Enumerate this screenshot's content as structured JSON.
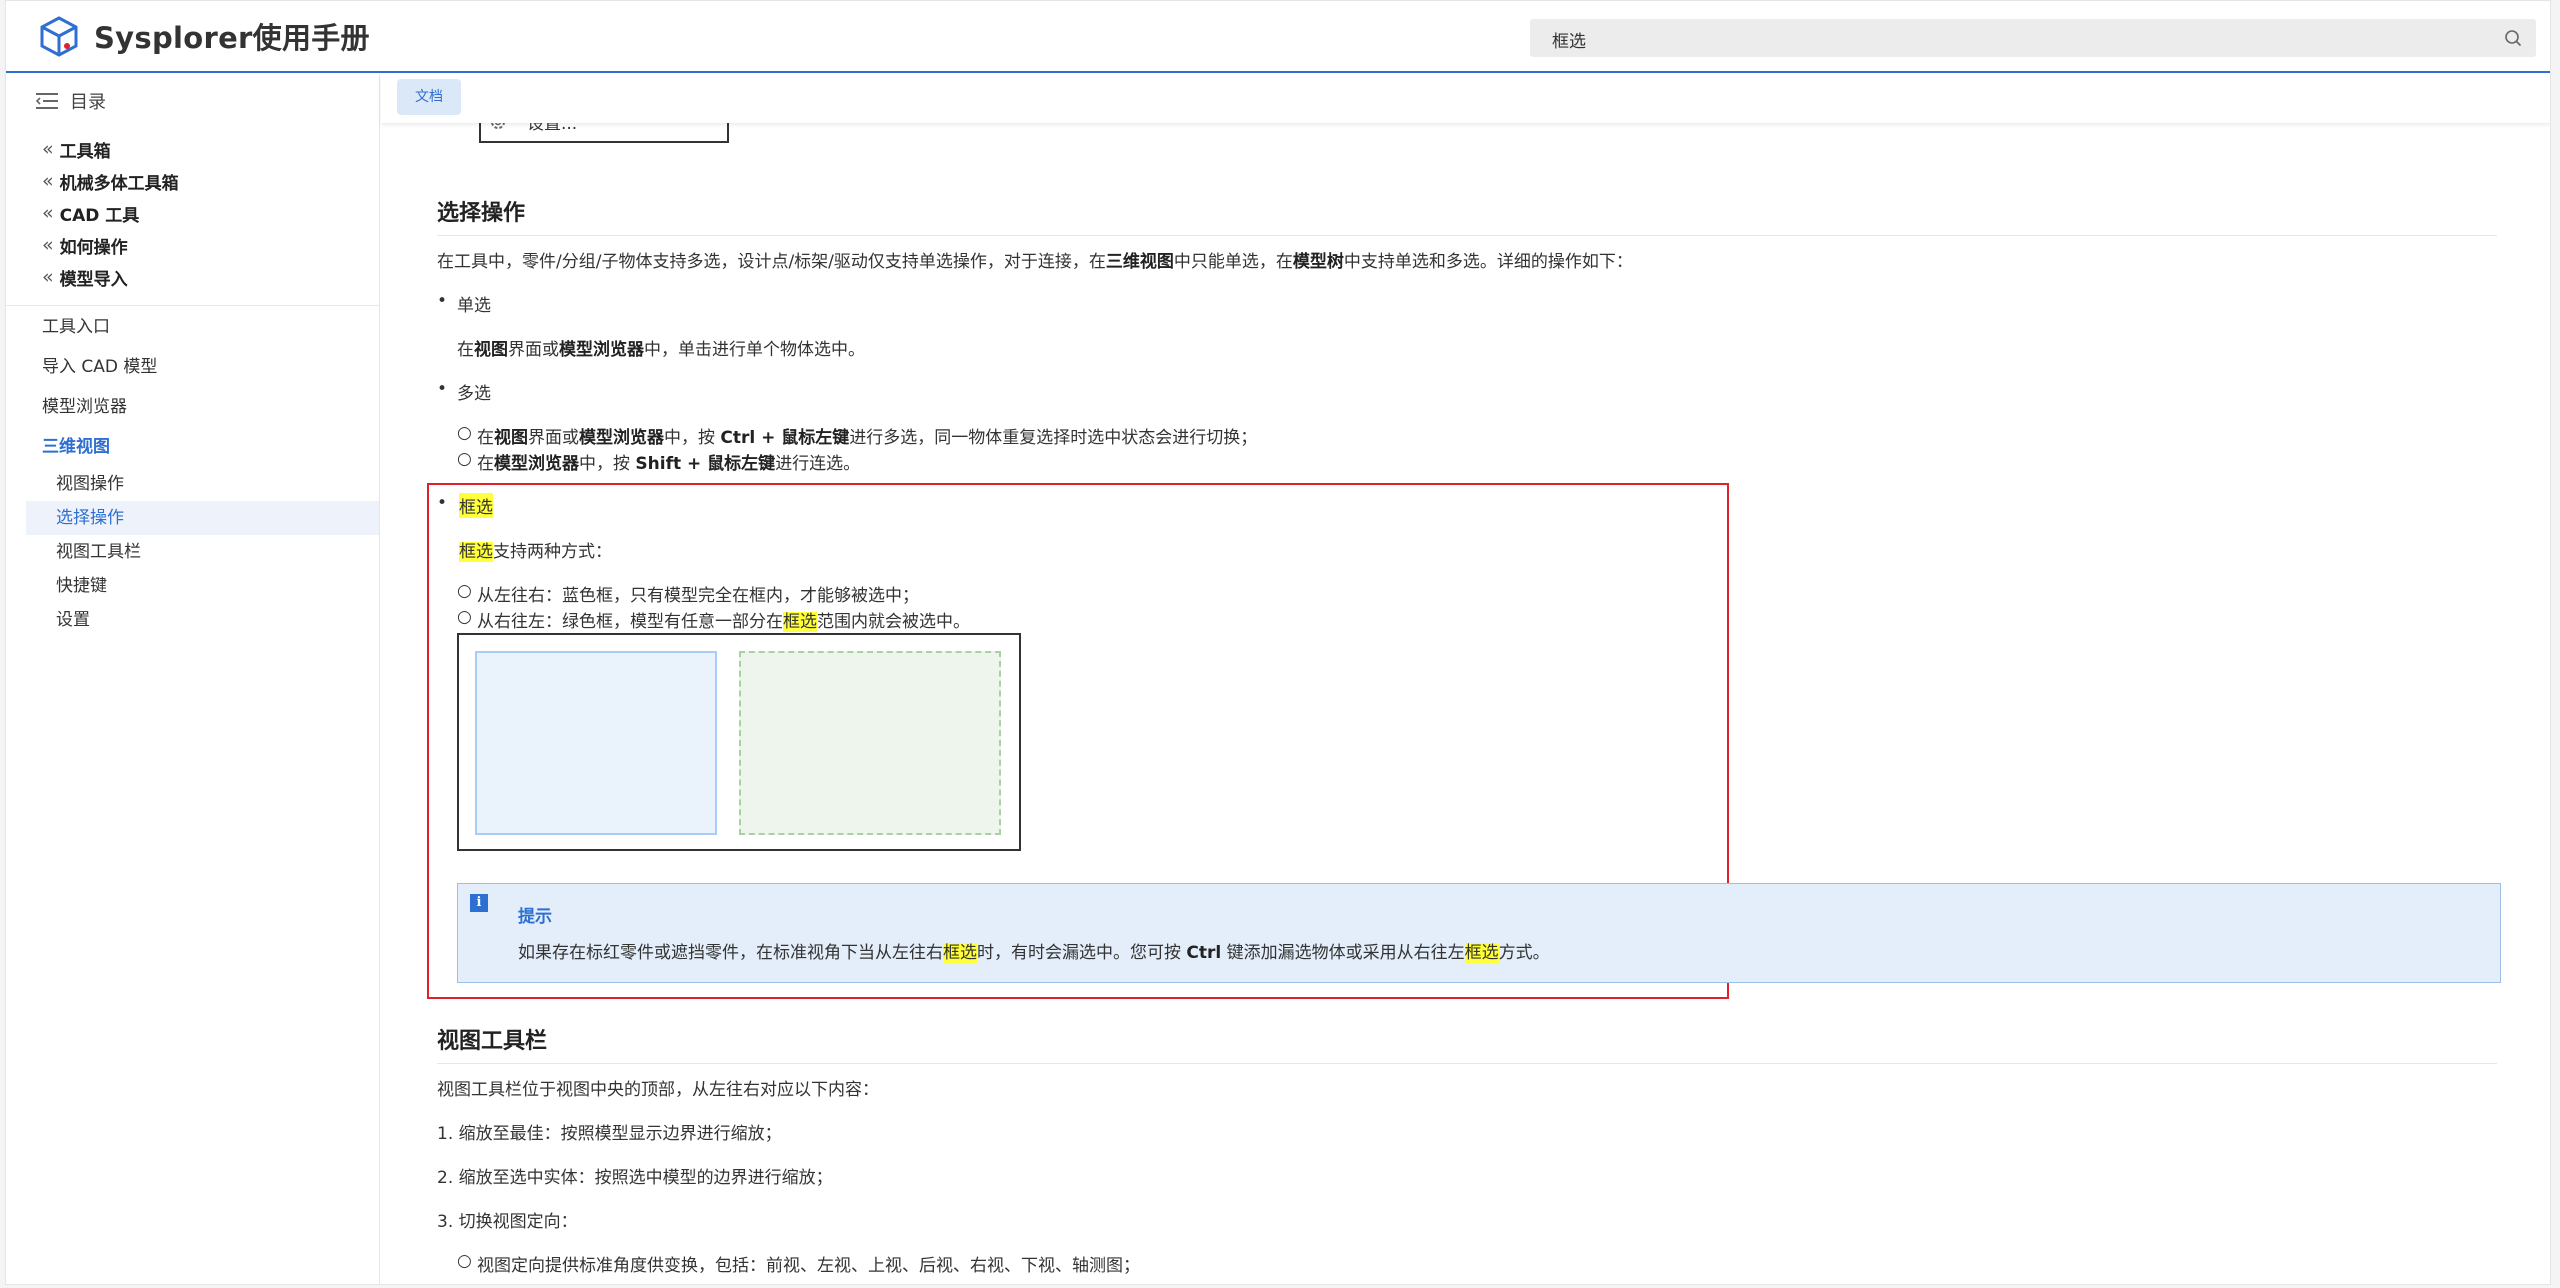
{
  "header": {
    "app_title": "Sysplorer使用手册",
    "search_value": "框选",
    "logo_icon": "cube-logo-icon",
    "search_icon": "search-icon",
    "accent_color": "#2f6fd1"
  },
  "sidebar": {
    "toc_label": "目录",
    "collapsed_sections": [
      "工具箱",
      "机械多体工具箱",
      "CAD 工具",
      "如何操作",
      "模型导入"
    ],
    "items": [
      "工具入口",
      "导入 CAD 模型",
      "模型浏览器",
      "三维视图"
    ],
    "active_item": "三维视图",
    "sub_items": [
      "视图操作",
      "选择操作",
      "视图工具栏",
      "快捷键",
      "设置"
    ],
    "active_sub_item": "选择操作"
  },
  "tabs": {
    "doc_tab": "文档"
  },
  "content": {
    "partial_item": "设置...",
    "section_select": {
      "title": "选择操作",
      "intro": {
        "a": "在工具中，零件/分组/子物体支持多选，设计点/标架/驱动仅支持单选操作，对于连接，在",
        "b1": "三维视图",
        "c": "中只能单选，在",
        "b2": "模型树",
        "d": "中支持单选和多选。详细的操作如下："
      },
      "single": {
        "label": "单选",
        "desc": {
          "a": "在",
          "b1": "视图",
          "c": "界面或",
          "b2": "模型浏览器",
          "d": "中，单击进行单个物体选中。"
        }
      },
      "multi": {
        "label": "多选",
        "items": [
          {
            "a": "在",
            "b1": "视图",
            "c": "界面或",
            "b2": "模型浏览器",
            "d": "中，按 ",
            "b3": "Ctrl + 鼠标左键",
            "e": "进行多选，同一物体重复选择时选中状态会进行切换；"
          },
          {
            "a": "在",
            "b1": "模型浏览器",
            "c": "中，按 ",
            "b2": "Shift + 鼠标左键",
            "d": "进行连选。"
          }
        ]
      },
      "box": {
        "label": "框选",
        "desc_hl": "框选",
        "desc_rest": "支持两种方式：",
        "item1": "从左往右：蓝色框，只有模型完全在框内，才能够被选中；",
        "item2_a": "从右往左：绿色框，模型有任意一部分在",
        "item2_hl": "框选",
        "item2_b": "范围内就会被选中。"
      },
      "tip": {
        "title": "提示",
        "a": "如果存在标红零件或遮挡零件，在标准视角下当从左往右",
        "hl1": "框选",
        "b": "时，有时会漏选中。您可按 ",
        "bold": "Ctrl",
        "c": " 键添加漏选物体或采用从右往左",
        "hl2": "框选",
        "d": "方式。"
      }
    },
    "section_toolbar": {
      "title": "视图工具栏",
      "intro": "视图工具栏位于视图中央的顶部，从左往右对应以下内容：",
      "items": [
        "1. 缩放至最佳：按照模型显示边界进行缩放；",
        "2. 缩放至选中实体：按照选中模型的边界进行缩放；",
        "3. 切换视图定向："
      ],
      "sub_item": "视图定向提供标准角度供变换，包括：前视、左视、上视、后视、右视、下视、轴测图；"
    }
  }
}
